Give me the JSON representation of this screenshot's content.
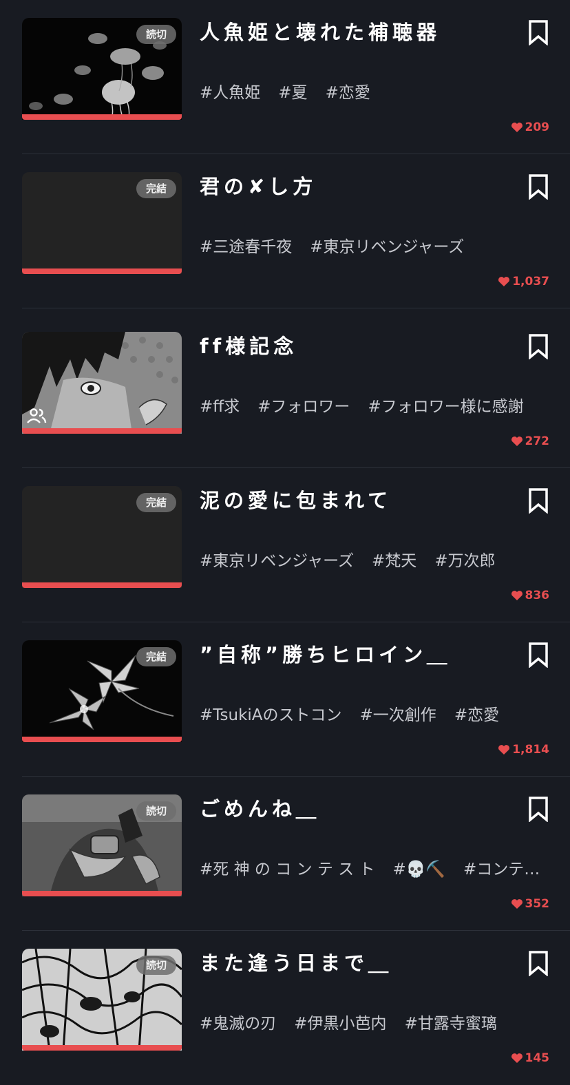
{
  "colors": {
    "background": "#181b22",
    "accent": "#e84e50",
    "tag_text": "#c7c9cf"
  },
  "stories": [
    {
      "title": "人魚姫と壊れた補聴器",
      "badge": "読切",
      "tags": [
        "#人魚姫",
        "#夏",
        "#恋愛"
      ],
      "likes": "209",
      "cover": "jellyfish"
    },
    {
      "title": "君の✘し方",
      "badge": "完結",
      "tags": [
        "#三途春千夜",
        "#東京リベンジャーズ"
      ],
      "likes": "1,037",
      "cover": "blank"
    },
    {
      "title": "ff様記念",
      "badge": "",
      "tags": [
        "#ff求",
        "#フォロワー",
        "#フォロワー様に感謝"
      ],
      "likes": "272",
      "cover": "manga-boy",
      "collab_icon": "group-icon"
    },
    {
      "title": "泥の愛に包まれて",
      "badge": "完結",
      "tags": [
        "#東京リベンジャーズ",
        "#梵天",
        "#万次郎"
      ],
      "likes": "836",
      "cover": "blank"
    },
    {
      "title": "”自称”勝ちヒロイン＿",
      "badge": "完結",
      "tags": [
        "#TsukiAのストコン",
        "#一次創作",
        "#恋愛"
      ],
      "likes": "1,814",
      "cover": "lilies"
    },
    {
      "title": "ごめんね＿",
      "badge": "読切",
      "tags": [
        "#死 神 の コ ン テ ス ト",
        "#💀⛏️",
        "#コンテ…"
      ],
      "likes": "352",
      "cover": "hands"
    },
    {
      "title": "また逢う日まで＿",
      "badge": "読切",
      "tags": [
        "#鬼滅の刃",
        "#伊黒小芭内",
        "#甘露寺蜜璃"
      ],
      "likes": "145",
      "cover": "manga-face"
    }
  ]
}
